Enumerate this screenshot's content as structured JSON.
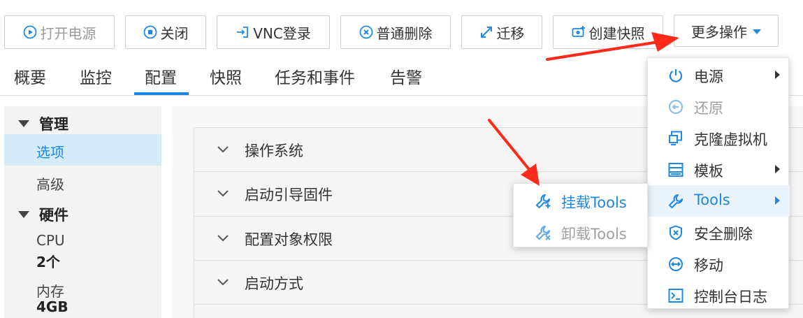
{
  "toolbar": {
    "power_on": "打开电源",
    "shutdown": "关闭",
    "vnc_login": "VNC登录",
    "normal_delete": "普通删除",
    "migrate": "迁移",
    "create_snapshot": "创建快照",
    "more_actions": "更多操作"
  },
  "tabs": [
    "概要",
    "监控",
    "配置",
    "快照",
    "任务和事件",
    "告警"
  ],
  "active_tab": "配置",
  "left_panel": {
    "group_manage": "管理",
    "options": "选项",
    "advanced": "高级",
    "group_hardware": "硬件",
    "cpu_label": "CPU",
    "cpu_value": "2个",
    "memory_label": "内存",
    "memory_value": "4GB"
  },
  "accordion": [
    "操作系统",
    "启动引导固件",
    "配置对象权限",
    "启动方式"
  ],
  "more_menu": [
    {
      "label": "电源",
      "icon": "power-icon",
      "submenu": true,
      "disabled": false
    },
    {
      "label": "还原",
      "icon": "restore-icon",
      "submenu": false,
      "disabled": true
    },
    {
      "label": "克隆虚拟机",
      "icon": "clone-vm-icon",
      "submenu": false,
      "disabled": false
    },
    {
      "label": "模板",
      "icon": "template-icon",
      "submenu": true,
      "disabled": false
    },
    {
      "label": "Tools",
      "icon": "wrench-icon",
      "submenu": true,
      "disabled": false,
      "highlighted": true
    },
    {
      "label": "安全删除",
      "icon": "secure-delete-icon",
      "submenu": false,
      "disabled": false
    },
    {
      "label": "移动",
      "icon": "move-icon",
      "submenu": false,
      "disabled": false
    },
    {
      "label": "控制台日志",
      "icon": "console-log-icon",
      "submenu": false,
      "disabled": false
    }
  ],
  "tools_submenu": [
    {
      "label": "挂载Tools",
      "icon": "mount-tools-icon",
      "disabled": false
    },
    {
      "label": "卸载Tools",
      "icon": "unmount-tools-icon",
      "disabled": true
    }
  ],
  "colors": {
    "accent": "#1e88e5",
    "annotation_arrow": "#ff2a1a",
    "selected_bg": "#d6ebfa",
    "disabled_text": "#a0a0a0"
  }
}
